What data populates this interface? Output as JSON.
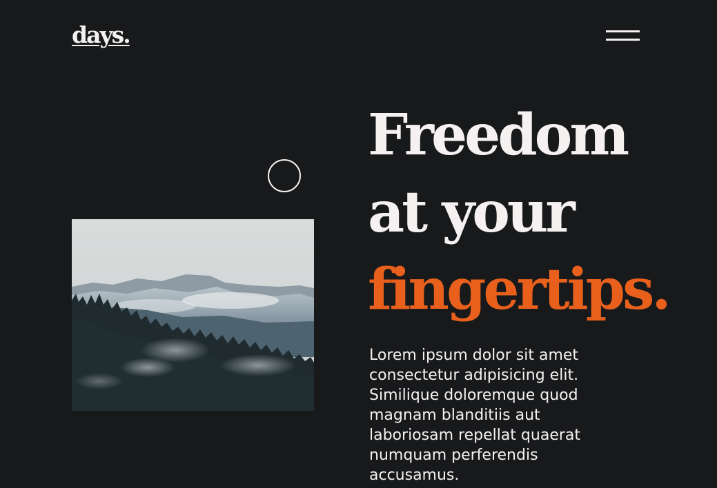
{
  "header": {
    "logo": "days.",
    "menu_icon": "hamburger-icon"
  },
  "hero": {
    "image_subject": "misty mountain forest",
    "cursor_icon": "circle-cursor-icon",
    "headline": {
      "line1": "Freedom",
      "line2": "at your",
      "line3": "fingertips."
    },
    "body": "Lorem ipsum dolor sit amet consectetur adipisicing elit. Similique doloremque quod magnam blanditiis aut laboriosam repellat quaerat numquam perferendis accusamus."
  },
  "colors": {
    "background": "#18191b",
    "text": "#f6f1f1",
    "accent": "#e8601c"
  }
}
